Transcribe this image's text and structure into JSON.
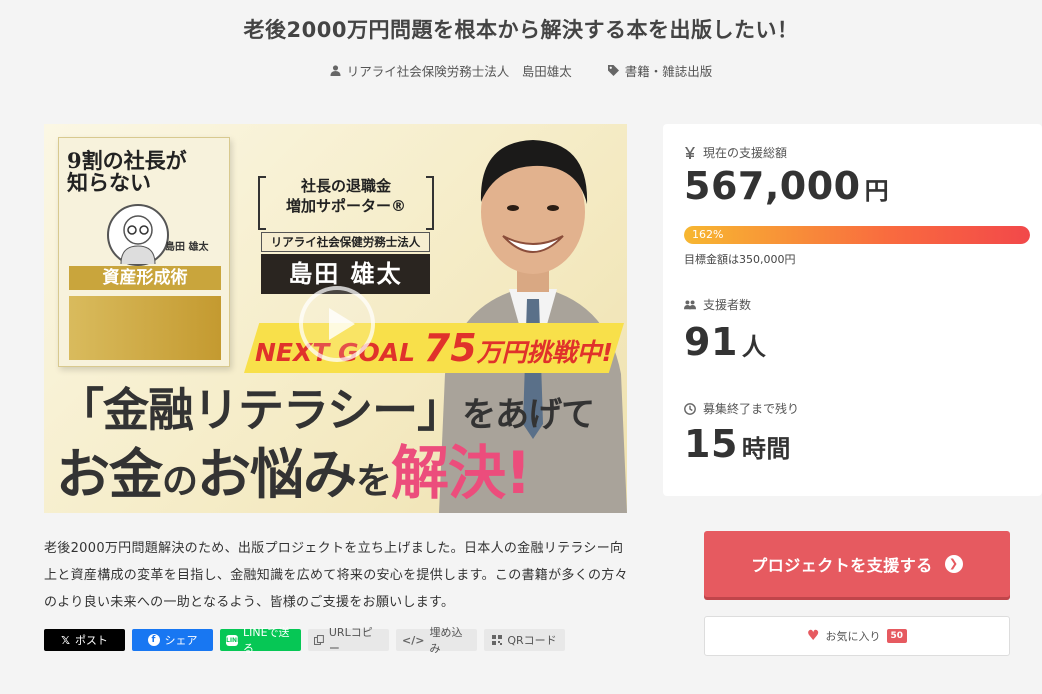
{
  "header": {
    "title": "老後2000万円問題を根本から解決する本を出版したい！",
    "owner": "リアライ社会保険労務士法人　島田雄太",
    "category": "書籍・雑誌出版"
  },
  "hero": {
    "book_title": "9割の社長が知らない",
    "book_author": "島田 雄太",
    "book_subtitle": "資産形成術",
    "badge_line1": "社長の退職金",
    "badge_line2": "増加サポーター®",
    "corp": "リアライ社会保健労務士法人",
    "name": "島田 雄太",
    "goal_prefix": "NEXT GOAL ",
    "goal_amount": "75",
    "goal_suffix": "万円挑戦中!",
    "headline1_main": "「金融リテラシー」",
    "headline1_tail": "をあげて",
    "headline2_a": "お金",
    "headline2_b": "の",
    "headline2_c": "お悩み",
    "headline2_d": "を",
    "headline2_e": "解決!"
  },
  "stats": {
    "amount_label": "現在の支援総額",
    "amount": "567,000",
    "amount_unit": "円",
    "progress_text": "162%",
    "progress_ratio": 1.0,
    "goal_text": "目標金額は350,000円",
    "backers_label": "支援者数",
    "backers": "91",
    "backers_unit": "人",
    "remaining_label": "募集終了まで残り",
    "remaining": "15",
    "remaining_unit": "時間"
  },
  "description": "老後2000万円問題解決のため、出版プロジェクトを立ち上げました。日本人の金融リテラシー向上と資産構成の変革を目指し、金融知識を広めて将来の安心を提供します。この書籍が多くの方々のより良い未来への一助となるよう、皆様のご支援をお願いします。",
  "share": {
    "x": "ポスト",
    "facebook": "シェア",
    "line": "LINEで送る",
    "url": "URLコピー",
    "embed": "埋め込み",
    "qr": "QRコード"
  },
  "cta": {
    "support": "プロジェクトを支援する",
    "favorite": "お気に入り",
    "favorite_count": "50"
  },
  "colors": {
    "accent": "#e65a60",
    "progress_start": "#f7b731",
    "progress_end": "#f2484a"
  }
}
